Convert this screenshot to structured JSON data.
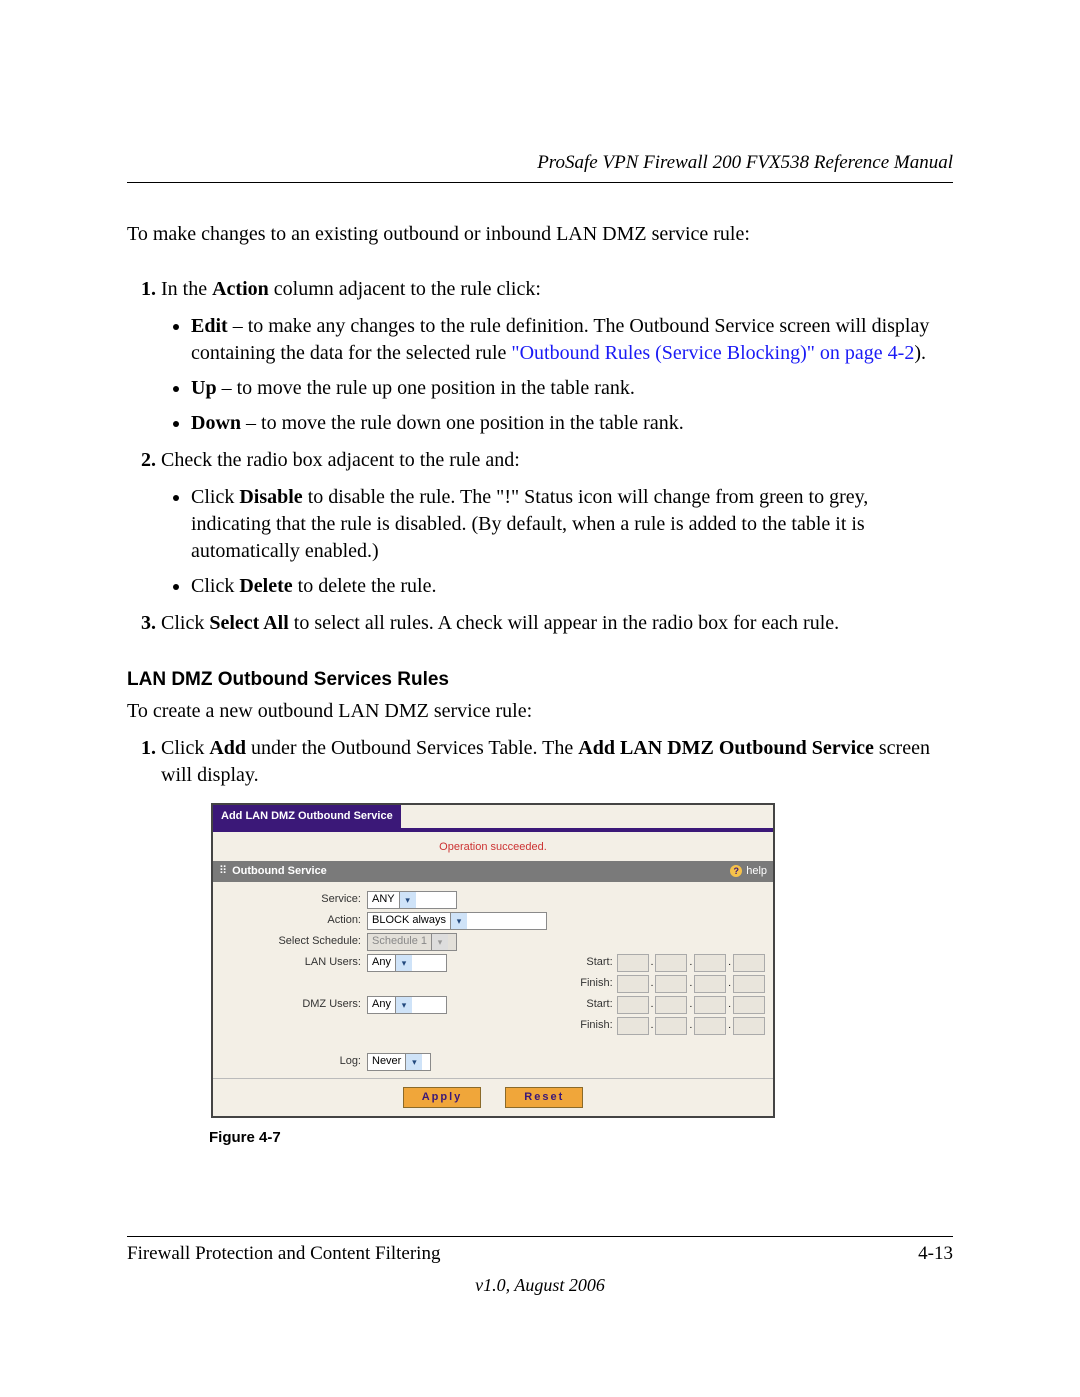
{
  "header": {
    "title": "ProSafe VPN Firewall 200 FVX538 Reference Manual"
  },
  "intro": "To make changes to an existing outbound or inbound LAN DMZ service rule:",
  "step1": {
    "lead_a": "In the ",
    "bold": "Action",
    "lead_b": " column adjacent to the rule click:",
    "edit": {
      "bold": "Edit",
      "text": " – to make any changes to the rule definition. The Outbound Service screen will display containing the data for the selected rule ",
      "link": "\"Outbound Rules (Service Blocking)\" on page 4-2",
      "after": ")."
    },
    "up": {
      "bold": "Up",
      "text": " – to move the rule up one position in the table rank."
    },
    "down": {
      "bold": "Down",
      "text": " – to move the rule down one position in the table rank."
    }
  },
  "step2": {
    "lead": "Check the radio box adjacent to the rule and:",
    "disable": {
      "a": "Click ",
      "bold": "Disable",
      "b": " to disable the rule. The \"!\" Status icon will change from green to grey, indicating that the rule is disabled. (By default, when a rule is added to the table it is automatically enabled.)"
    },
    "delete": {
      "a": "Click ",
      "bold": "Delete",
      "b": " to delete the rule."
    }
  },
  "step3": {
    "a": "Click ",
    "b1": "Select All",
    "c": " to select all rules. A check will appear in the radio box for each rule."
  },
  "section_heading": "LAN DMZ Outbound Services Rules",
  "section_intro": "To create a new outbound LAN DMZ service rule:",
  "sec_step1": {
    "a": "Click ",
    "b1": "Add",
    "c": " under the Outbound Services Table. The ",
    "b2": "Add LAN DMZ Outbound Service",
    "d": " screen will display."
  },
  "ui": {
    "tab": "Add LAN DMZ Outbound Service",
    "status": "Operation succeeded.",
    "section": "Outbound Service",
    "help": "help",
    "labels": {
      "service": "Service:",
      "action": "Action:",
      "schedule": "Select Schedule:",
      "lan": "LAN Users:",
      "dmz": "DMZ Users:",
      "log": "Log:",
      "start": "Start:",
      "finish": "Finish:"
    },
    "values": {
      "service": "ANY",
      "action": "BLOCK always",
      "schedule": "Schedule 1",
      "lan": "Any",
      "dmz": "Any",
      "log": "Never"
    },
    "apply": "Apply",
    "reset": "Reset"
  },
  "figure_label": "Figure 4-7",
  "footer": {
    "left": "Firewall Protection and Content Filtering",
    "right": "4-13",
    "version": "v1.0, August 2006"
  }
}
